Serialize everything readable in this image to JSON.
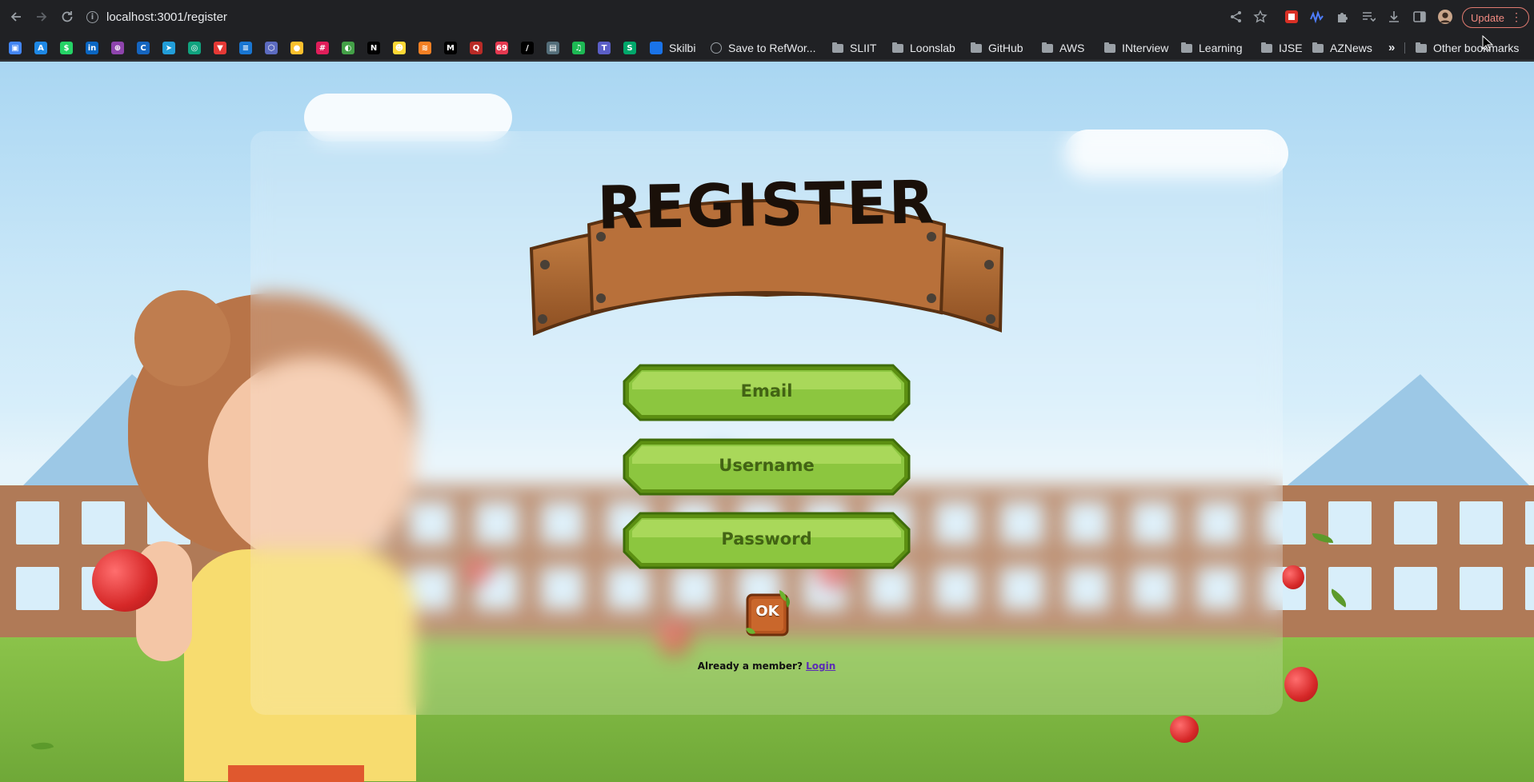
{
  "browser": {
    "url": "localhost:3001/register",
    "update_label": "Update",
    "bookmarks_overflow": "»",
    "bookmarks": [
      {
        "label": "Skilbi",
        "type": "favicon"
      },
      {
        "label": "Save to RefWor...",
        "type": "globe"
      },
      {
        "label": "SLIIT",
        "type": "folder"
      },
      {
        "label": "Loonslab",
        "type": "folder"
      },
      {
        "label": "GitHub",
        "type": "folder"
      },
      {
        "label": "AWS",
        "type": "folder"
      },
      {
        "label": "INterview",
        "type": "folder"
      },
      {
        "label": "Learning",
        "type": "folder"
      },
      {
        "label": "IJSE",
        "type": "folder"
      },
      {
        "label": "AZNews",
        "type": "folder"
      }
    ],
    "other_bookmarks": "Other bookmarks",
    "favicons": [
      {
        "glyph": "▣",
        "color": "#4285f4"
      },
      {
        "glyph": "A",
        "color": "#1e88e5"
      },
      {
        "glyph": "$",
        "color": "#25d366"
      },
      {
        "glyph": "in",
        "color": "#0a66c2"
      },
      {
        "glyph": "⊕",
        "color": "#8e44ad"
      },
      {
        "glyph": "C",
        "color": "#1565c0"
      },
      {
        "glyph": "➤",
        "color": "#229ed9"
      },
      {
        "glyph": "◎",
        "color": "#10a37f"
      },
      {
        "glyph": "▼",
        "color": "#e53935"
      },
      {
        "glyph": "≡",
        "color": "#1976d2"
      },
      {
        "glyph": "⬡",
        "color": "#5c6bc0"
      },
      {
        "glyph": "●",
        "color": "#fbc02d"
      },
      {
        "glyph": "#",
        "color": "#e01e5a"
      },
      {
        "glyph": "◐",
        "color": "#43a047"
      },
      {
        "glyph": "N",
        "color": "#000000"
      },
      {
        "glyph": "☻",
        "color": "#fdd835"
      },
      {
        "glyph": "≋",
        "color": "#f48024"
      },
      {
        "glyph": "M",
        "color": "#000000"
      },
      {
        "glyph": "Q",
        "color": "#b92b27"
      },
      {
        "glyph": "69",
        "color": "#e53950"
      },
      {
        "glyph": "/",
        "color": "#000000"
      },
      {
        "glyph": "▤",
        "color": "#546e7a"
      },
      {
        "glyph": "♫",
        "color": "#1db954"
      },
      {
        "glyph": "T",
        "color": "#5b5fc7"
      },
      {
        "glyph": "S",
        "color": "#00a86b"
      }
    ]
  },
  "page": {
    "title": "REGISTER",
    "fields": {
      "email_placeholder": "Email",
      "username_placeholder": "Username",
      "password_placeholder": "Password"
    },
    "ok_label": "OK",
    "already_member_text": "Already a member?",
    "login_link": "Login"
  },
  "colors": {
    "chrome_bg": "#202124",
    "field_green": "#8cc63f",
    "wood": "#b56a35",
    "link": "#5b2bb5"
  }
}
